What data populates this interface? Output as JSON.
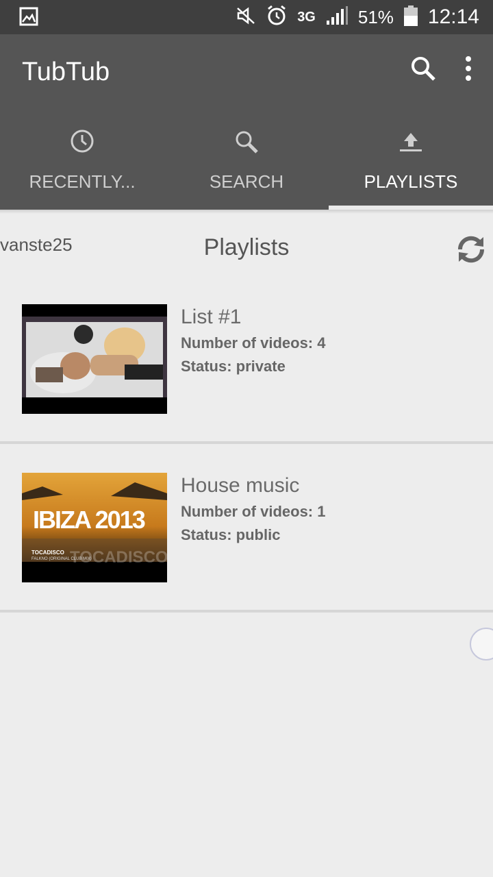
{
  "status_bar": {
    "left_icon": "image-icon",
    "network": "3G",
    "battery": "51%",
    "time": "12:14"
  },
  "app_bar": {
    "title": "TubTub",
    "actions": [
      "search-icon",
      "more-vert-icon"
    ]
  },
  "tabs": [
    {
      "label": "RECENTLY...",
      "icon": "clock-icon",
      "active": false
    },
    {
      "label": "SEARCH",
      "icon": "search-icon",
      "active": false
    },
    {
      "label": "PLAYLISTS",
      "icon": "upload-icon",
      "active": true
    }
  ],
  "header": {
    "username": "vanste25",
    "title": "Playlists"
  },
  "playlists": [
    {
      "name": "List #1",
      "count": "Number of videos: 4",
      "status": "Status: private"
    },
    {
      "name": "House music",
      "count": "Number of videos: 1",
      "status": "Status: public"
    }
  ],
  "thumb_texts": {
    "ibiza_title": "IBIZA 2013",
    "ibiza_artist": "TOCADISCO",
    "ibiza_sub": "FALKNO (ORIGINAL CLUB MIX)",
    "ibiza_watermark": "TOCADISCO"
  }
}
